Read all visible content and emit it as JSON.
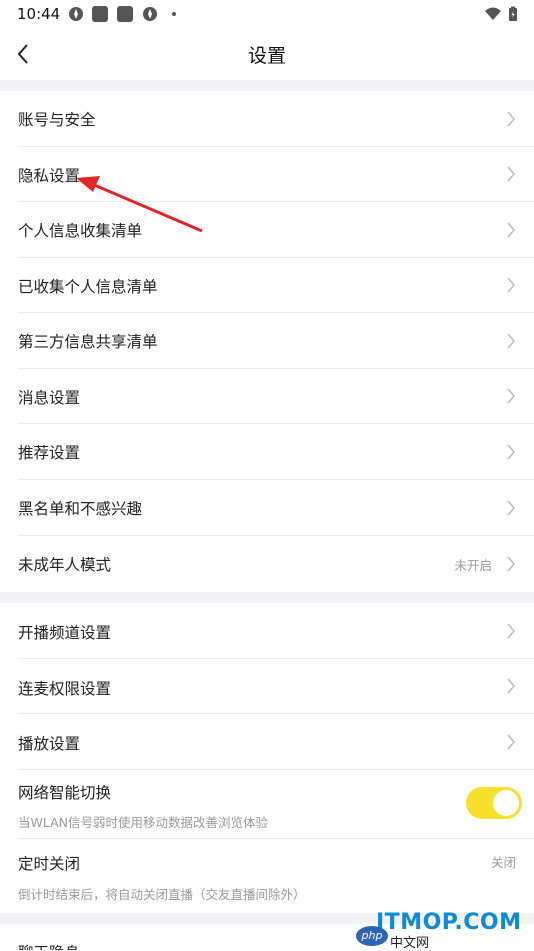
{
  "status_bar": {
    "time": "10:44"
  },
  "header": {
    "title": "设置"
  },
  "group1": [
    {
      "label": "账号与安全"
    },
    {
      "label": "隐私设置"
    },
    {
      "label": "个人信息收集清单"
    },
    {
      "label": "已收集个人信息清单"
    },
    {
      "label": "第三方信息共享清单"
    },
    {
      "label": "消息设置"
    },
    {
      "label": "推荐设置"
    },
    {
      "label": "黑名单和不感兴趣"
    },
    {
      "label": "未成年人模式",
      "value": "未开启"
    }
  ],
  "group2": [
    {
      "label": "开播频道设置"
    },
    {
      "label": "连麦权限设置"
    },
    {
      "label": "播放设置"
    },
    {
      "label": "网络智能切换",
      "sub": "当WLAN信号弱时使用移动数据改善浏览体验",
      "toggle_on": true
    },
    {
      "label": "定时关闭",
      "sub": "倒计时结束后，将自动关闭直播（交友直播间除外）",
      "value": "关闭"
    }
  ],
  "group3": [
    {
      "label": "聊天隐身"
    }
  ],
  "watermark": {
    "main": "ITMOP.COM",
    "php": "php",
    "cn": "中文网"
  },
  "colors": {
    "toggle": "#f8df2b",
    "arrow": "#e0262b",
    "section_gap": "#f2f2f5"
  }
}
